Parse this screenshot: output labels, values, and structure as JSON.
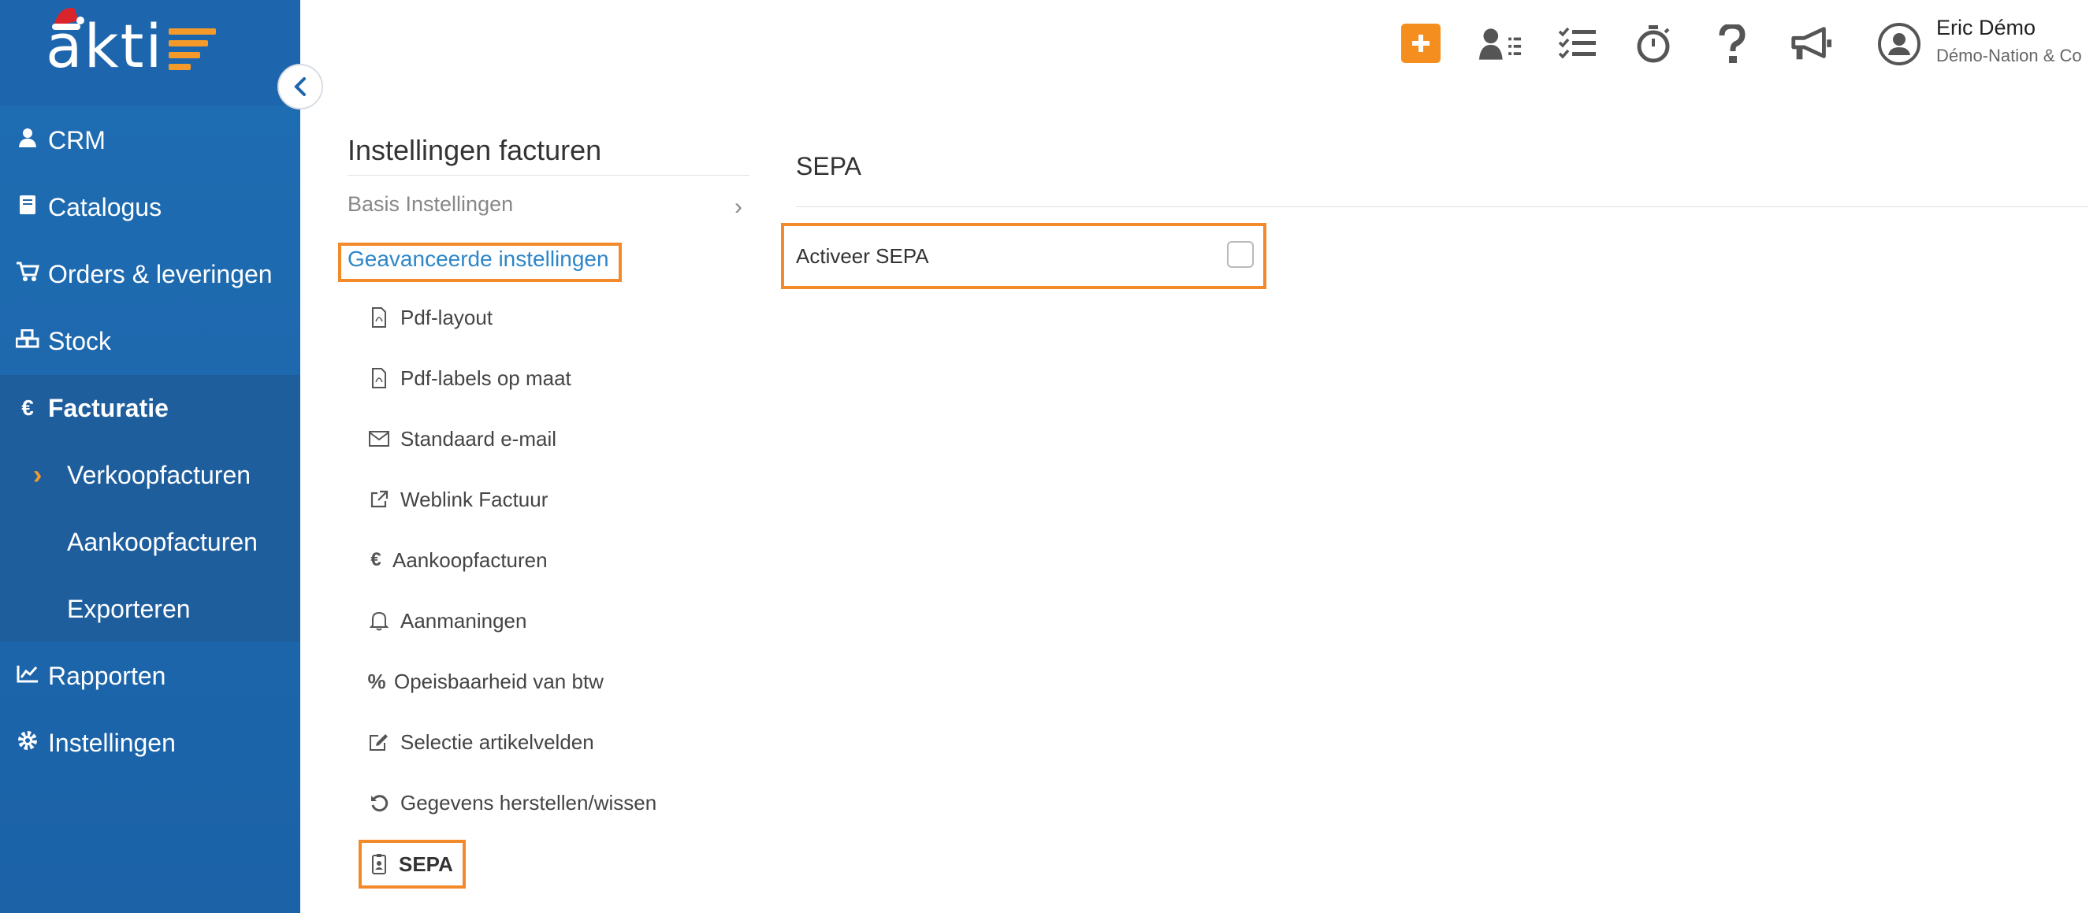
{
  "app": {
    "logo_text": "akti",
    "accent_color": "#f49a2b",
    "sidebar_color": "#1d66ad"
  },
  "sidebar": {
    "items": [
      {
        "label": "CRM",
        "icon": "user-icon"
      },
      {
        "label": "Catalogus",
        "icon": "book-icon"
      },
      {
        "label": "Orders & leveringen",
        "icon": "cart-icon"
      },
      {
        "label": "Stock",
        "icon": "boxes-icon"
      },
      {
        "label": "Facturatie",
        "icon": "euro-icon",
        "active": true
      },
      {
        "label": "Verkoopfacturen",
        "sub": true,
        "selected": true
      },
      {
        "label": "Aankoopfacturen",
        "sub": true
      },
      {
        "label": "Exporteren",
        "sub": true
      },
      {
        "label": "Rapporten",
        "icon": "chart-icon"
      },
      {
        "label": "Instellingen",
        "icon": "gear-icon"
      }
    ]
  },
  "header": {
    "user_name": "Eric Démo",
    "user_company": "Démo-Nation & Co"
  },
  "settings": {
    "title": "Instellingen facturen",
    "basis_label": "Basis Instellingen",
    "advanced_label": "Geavanceerde instellingen",
    "menu": [
      {
        "label": "Pdf-layout",
        "icon": "pdf-icon"
      },
      {
        "label": "Pdf-labels op maat",
        "icon": "pdf-icon"
      },
      {
        "label": "Standaard e-mail",
        "icon": "envelope-icon"
      },
      {
        "label": "Weblink Factuur",
        "icon": "external-link-icon"
      },
      {
        "label": "Aankoopfacturen",
        "icon": "euro-icon"
      },
      {
        "label": "Aanmaningen",
        "icon": "bell-icon"
      },
      {
        "label": "Opeisbaarheid van btw",
        "icon": "percent-icon"
      },
      {
        "label": "Selectie artikelvelden",
        "icon": "edit-icon"
      },
      {
        "label": "Gegevens herstellen/wissen",
        "icon": "undo-icon"
      },
      {
        "label": "SEPA",
        "icon": "id-badge-icon",
        "active": true
      }
    ]
  },
  "panel": {
    "title": "SEPA",
    "activate_label": "Activeer SEPA",
    "activate_checked": false
  }
}
